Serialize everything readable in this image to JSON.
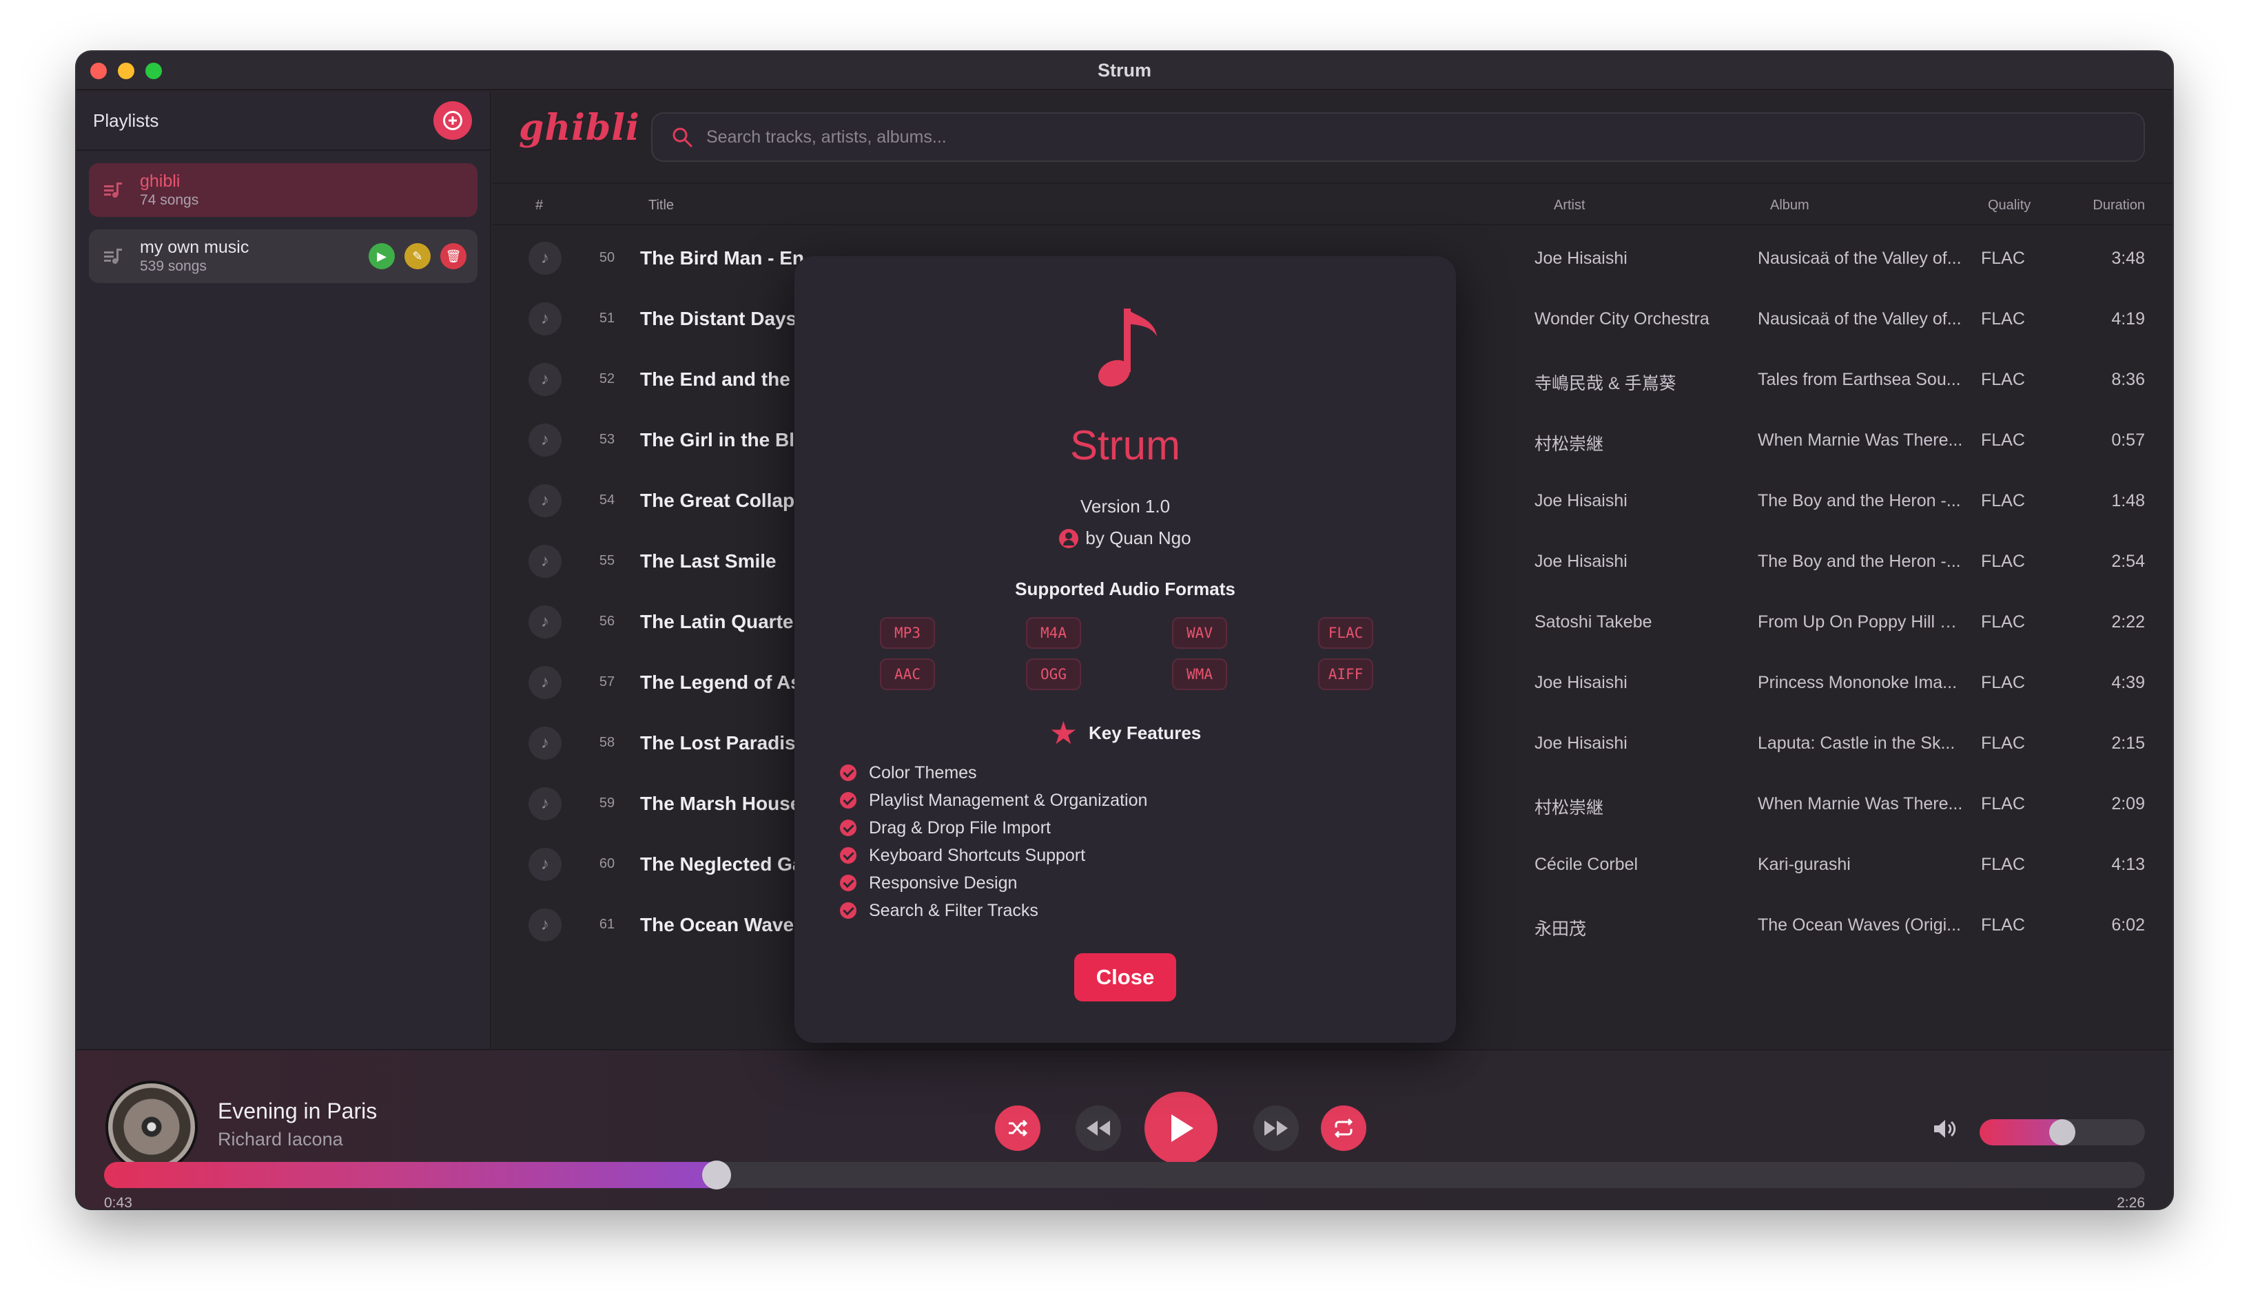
{
  "window": {
    "title": "Strum"
  },
  "sidebar": {
    "title": "Playlists",
    "playlists": [
      {
        "name": "ghibli",
        "count": "74 songs",
        "active": true
      },
      {
        "name": "my own music",
        "count": "539 songs",
        "active": false
      }
    ]
  },
  "header": {
    "logo": "ghibli",
    "search_placeholder": "Search tracks, artists, albums..."
  },
  "table": {
    "columns": {
      "num": "#",
      "title": "Title",
      "artist": "Artist",
      "album": "Album",
      "quality": "Quality",
      "duration": "Duration"
    },
    "rows": [
      {
        "num": "50",
        "title": "The Bird Man - En",
        "artist": "Joe Hisaishi",
        "album": "Nausicaä of the Valley of...",
        "quality": "FLAC",
        "duration": "3:48"
      },
      {
        "num": "51",
        "title": "The Distant Days",
        "artist": "Wonder City Orchestra",
        "album": "Nausicaä of the Valley of...",
        "quality": "FLAC",
        "duration": "4:19"
      },
      {
        "num": "52",
        "title": "The End and the E",
        "artist": "寺嶋民哉 & 手嶌葵",
        "album": "Tales from Earthsea Sou...",
        "quality": "FLAC",
        "duration": "8:36"
      },
      {
        "num": "53",
        "title": "The Girl in the Blu",
        "artist": "村松崇継",
        "album": "When Marnie Was There...",
        "quality": "FLAC",
        "duration": "0:57"
      },
      {
        "num": "54",
        "title": "The Great Collaps",
        "artist": "Joe Hisaishi",
        "album": "The Boy and the Heron -...",
        "quality": "FLAC",
        "duration": "1:48"
      },
      {
        "num": "55",
        "title": "The Last Smile",
        "artist": "Joe Hisaishi",
        "album": "The Boy and the Heron -...",
        "quality": "FLAC",
        "duration": "2:54"
      },
      {
        "num": "56",
        "title": "The Latin Quarter",
        "artist": "Satoshi Takebe",
        "album": "From Up On Poppy Hill S...",
        "quality": "FLAC",
        "duration": "2:22"
      },
      {
        "num": "57",
        "title": "The Legend of Asl",
        "artist": "Joe Hisaishi",
        "album": "Princess Mononoke Ima...",
        "quality": "FLAC",
        "duration": "4:39"
      },
      {
        "num": "58",
        "title": "The Lost Paradise",
        "artist": "Joe Hisaishi",
        "album": "Laputa: Castle in the Sk...",
        "quality": "FLAC",
        "duration": "2:15"
      },
      {
        "num": "59",
        "title": "The Marsh House",
        "artist": "村松崇継",
        "album": "When Marnie Was There...",
        "quality": "FLAC",
        "duration": "2:09"
      },
      {
        "num": "60",
        "title": "The Neglected Ga",
        "artist": "Cécile Corbel",
        "album": "Kari-gurashi",
        "quality": "FLAC",
        "duration": "4:13"
      },
      {
        "num": "61",
        "title": "The Ocean Waves",
        "artist": "永田茂",
        "album": "The Ocean Waves (Origi...",
        "quality": "FLAC",
        "duration": "6:02"
      }
    ]
  },
  "player": {
    "track_title": "Evening in Paris",
    "track_artist": "Richard Iacona",
    "elapsed": "0:43",
    "total": "2:26",
    "progress": 0.3,
    "volume": 0.5,
    "accent": "#e23b5b"
  },
  "about_modal": {
    "app_name": "Strum",
    "version": "Version 1.0",
    "author": "by Quan Ngo",
    "formats_heading": "Supported Audio Formats",
    "formats": [
      "MP3",
      "M4A",
      "WAV",
      "FLAC",
      "AAC",
      "OGG",
      "WMA",
      "AIFF"
    ],
    "features_heading": "Key Features",
    "features": [
      "Color Themes",
      "Playlist Management & Organization",
      "Drag & Drop File Import",
      "Keyboard Shortcuts Support",
      "Responsive Design",
      "Search & Filter Tracks"
    ],
    "close_label": "Close"
  }
}
